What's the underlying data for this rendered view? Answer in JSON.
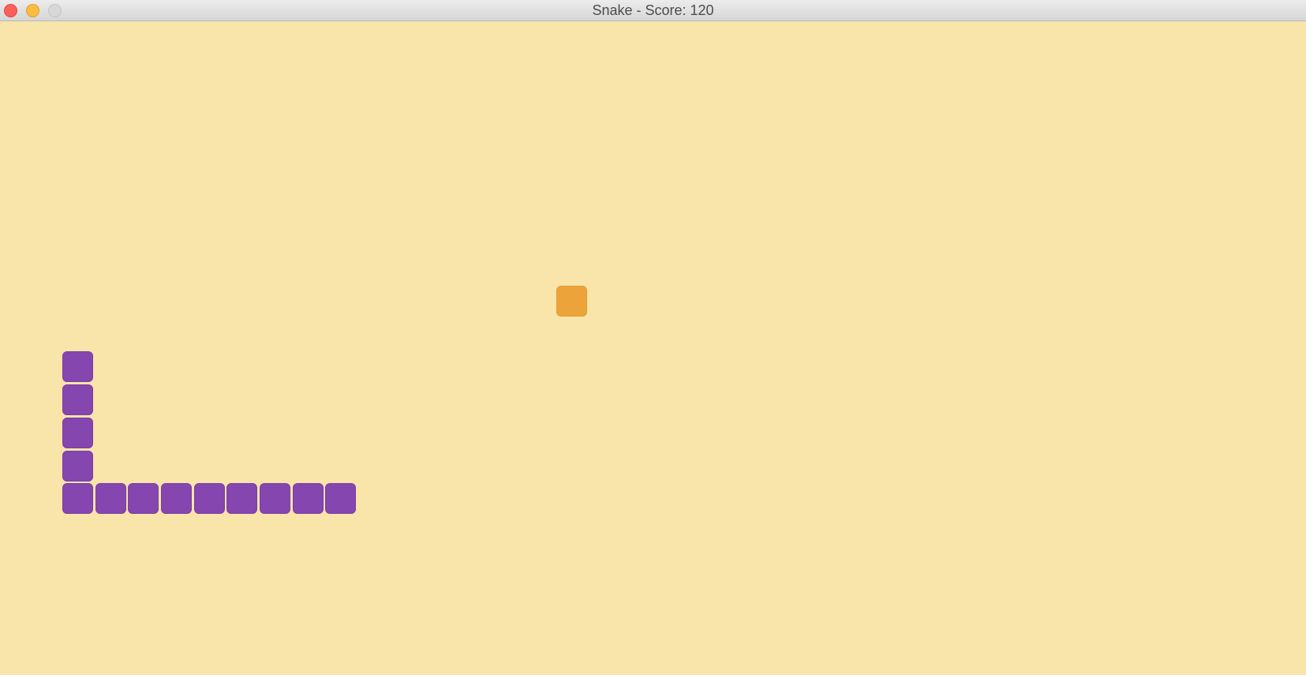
{
  "window": {
    "title": "Snake - Score: 120"
  },
  "colors": {
    "board": "#f9e5aa",
    "snake": "#8546b0",
    "food": "#eca43a"
  },
  "game": {
    "score": 120,
    "snake_length": 13,
    "food_count": 1
  }
}
